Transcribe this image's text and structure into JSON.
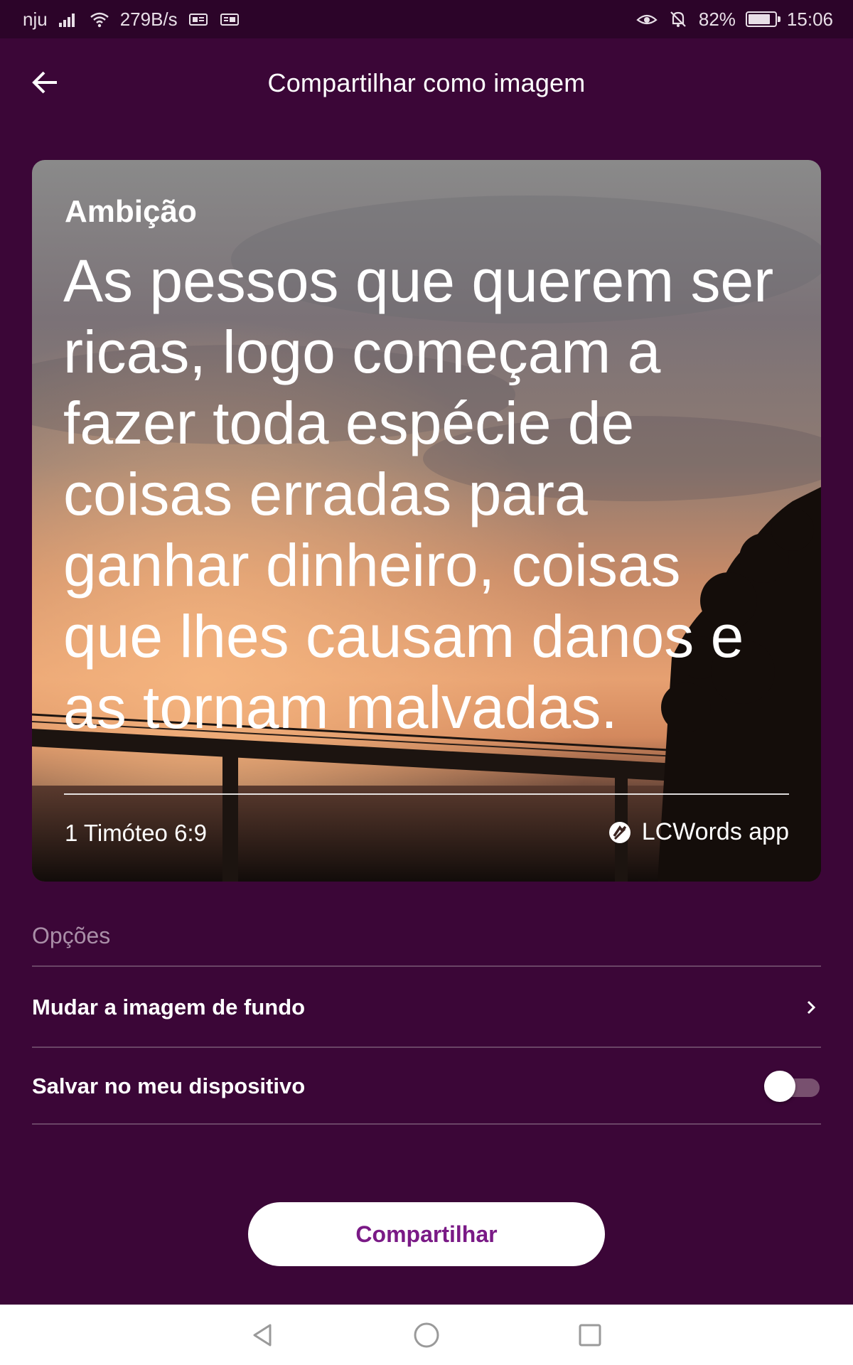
{
  "status_bar": {
    "carrier": "nju",
    "speed": "279B/s",
    "battery": "82%",
    "battery_level": 0.82,
    "time": "15:06",
    "icons": [
      "signal-icon",
      "wifi-icon",
      "notification-icon",
      "notification-icon",
      "eye-icon",
      "bell-off-icon",
      "battery-icon"
    ]
  },
  "app_bar": {
    "title": "Compartilhar como imagem",
    "back_icon": "arrow-left-icon"
  },
  "card": {
    "topic": "Ambição",
    "quote": "As pessos que querem ser ricas, logo começam a fazer toda espécie de coisas erradas para ganhar dinheiro, coisas que lhes causam danos e as tornam malvadas.",
    "reference": "1 Timóteo 6:9",
    "brand": "LCWords app",
    "brand_icon": "lcwords-logo-icon"
  },
  "options": {
    "label": "Opções",
    "items": [
      {
        "label": "Mudar a imagem de fundo",
        "type": "link",
        "icon": "chevron-right-icon"
      },
      {
        "label": "Salvar no meu dispositivo",
        "type": "toggle",
        "value": false
      }
    ]
  },
  "share_button": {
    "label": "Compartilhar"
  },
  "nav_bar": {
    "icons": [
      "back-triangle-icon",
      "home-circle-icon",
      "recents-square-icon"
    ]
  },
  "colors": {
    "background": "#3b0637",
    "status_bar": "#2c0429",
    "accent": "#7a1a86",
    "divider": "#6a4566",
    "muted_text": "#a98ea7"
  }
}
